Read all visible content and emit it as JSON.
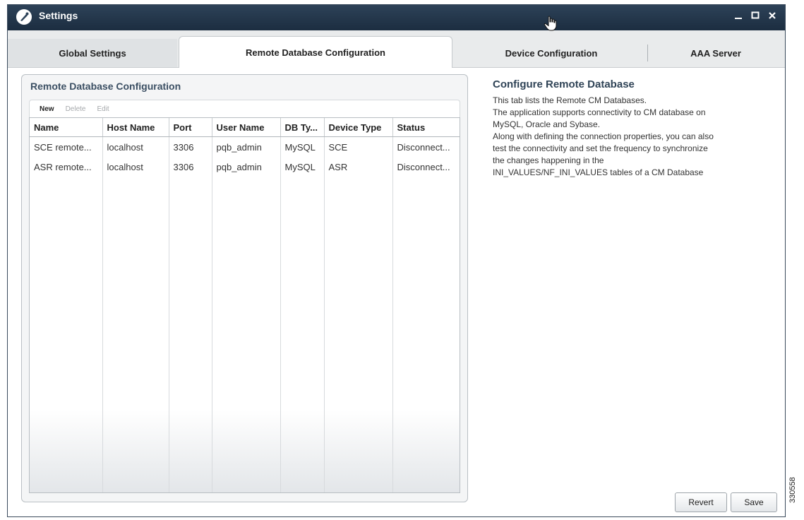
{
  "window": {
    "title": "Settings"
  },
  "tabs": [
    {
      "label": "Global Settings",
      "selected": false
    },
    {
      "label": "Remote Database Configuration",
      "selected": true
    },
    {
      "label": "Device Configuration",
      "selected": false
    },
    {
      "label": "AAA Server",
      "selected": false
    }
  ],
  "panel": {
    "title": "Remote Database Configuration",
    "toolbar": {
      "new_label": "New",
      "delete_label": "Delete",
      "edit_label": "Edit"
    },
    "columns": [
      "Name",
      "Host Name",
      "Port",
      "User Name",
      "DB Ty...",
      "Device Type",
      "Status"
    ],
    "rows": [
      [
        "SCE remote...",
        "localhost",
        "3306",
        "pqb_admin",
        "MySQL",
        "SCE",
        "Disconnect..."
      ],
      [
        "ASR remote...",
        "localhost",
        "3306",
        "pqb_admin",
        "MySQL",
        "ASR",
        "Disconnect..."
      ]
    ]
  },
  "description": {
    "title": "Configure Remote Database",
    "lines": [
      "This tab lists the Remote CM Databases.",
      "The application supports connectivity to CM database on",
      "MySQL, Oracle and Sybase.",
      "Along with defining the connection properties, you can also",
      "test the connectivity and set the frequency to synchronize",
      "the changes happening in the",
      "INI_VALUES/NF_INI_VALUES tables of a CM Database"
    ]
  },
  "buttons": {
    "revert_label": "Revert",
    "save_label": "Save"
  },
  "figure_id": "330558",
  "colors": {
    "titlebar": "#1c2d40",
    "panel_title": "#3b4f63"
  },
  "icons": [
    "settings-app-icon",
    "minimize-icon",
    "maximize-icon",
    "close-icon",
    "hand-cursor-icon"
  ]
}
